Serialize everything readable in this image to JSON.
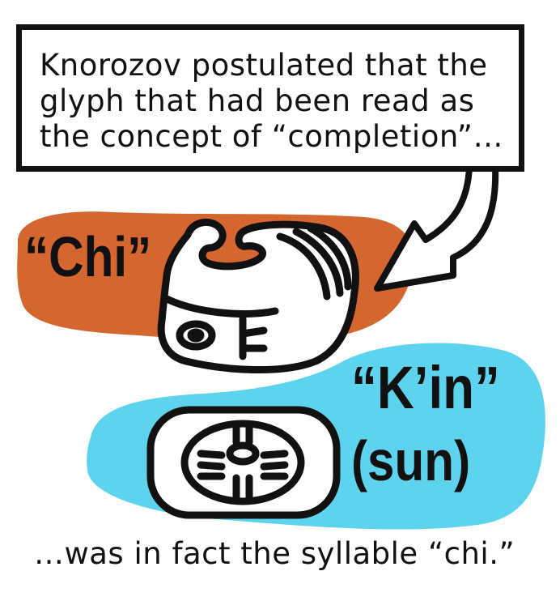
{
  "caption": {
    "lines": [
      "Knorozov postulated that the",
      "glyph that had been read as",
      "the concept of “completion”…"
    ]
  },
  "labels": {
    "chi": "“Chi”",
    "kin": "“K’in”",
    "sun": "(sun)"
  },
  "bottom_caption": "…was in fact the syllable “chi.”",
  "colors": {
    "orange_blob": "#D4662F",
    "blue_blob": "#5ED3EE",
    "ink": "#111111"
  },
  "icons": [
    "chi-glyph-icon",
    "kin-sun-glyph-icon",
    "pointer-arrow-icon"
  ]
}
